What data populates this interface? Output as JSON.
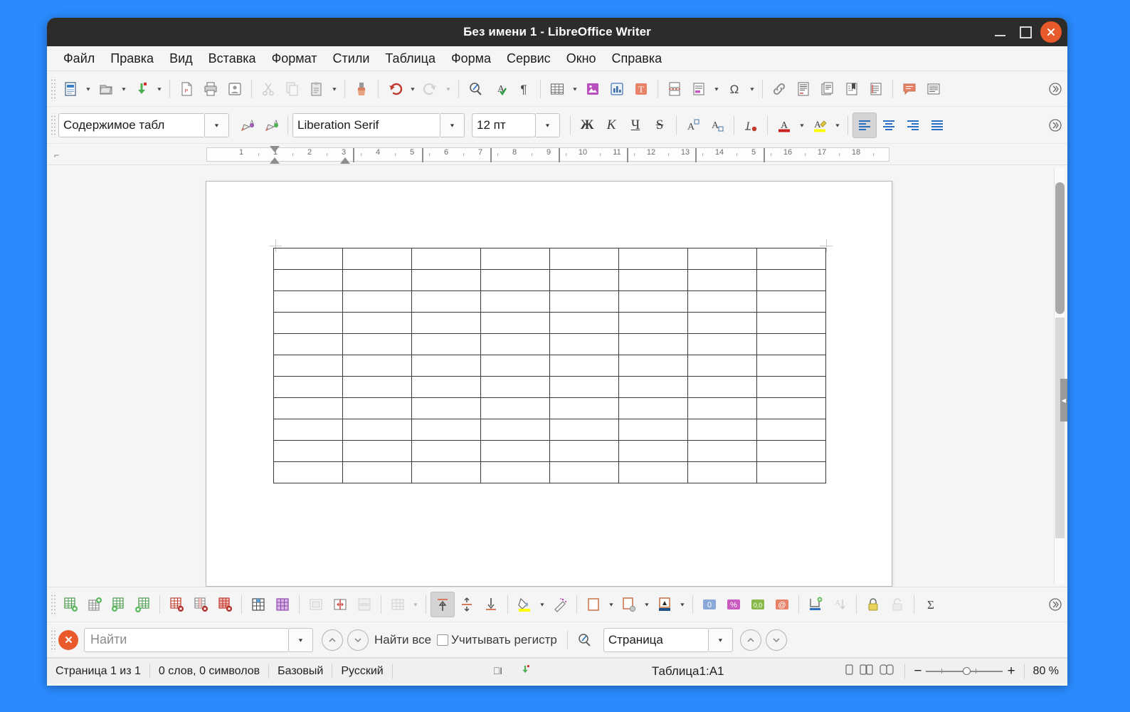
{
  "window": {
    "title": "Без имени 1 - LibreOffice Writer",
    "minimize": "—",
    "maximize": "□",
    "close": "✕"
  },
  "menubar": {
    "items": [
      {
        "label": "Файл",
        "name": "menu-file"
      },
      {
        "label": "Правка",
        "name": "menu-edit"
      },
      {
        "label": "Вид",
        "name": "menu-view"
      },
      {
        "label": "Вставка",
        "name": "menu-insert"
      },
      {
        "label": "Формат",
        "name": "menu-format"
      },
      {
        "label": "Стили",
        "name": "menu-styles"
      },
      {
        "label": "Таблица",
        "name": "menu-table"
      },
      {
        "label": "Форма",
        "name": "menu-form"
      },
      {
        "label": "Сервис",
        "name": "menu-tools"
      },
      {
        "label": "Окно",
        "name": "menu-window"
      },
      {
        "label": "Справка",
        "name": "menu-help"
      }
    ]
  },
  "standard_toolbar": {
    "overflow_label": "»",
    "buttons": [
      {
        "name": "new-document-icon",
        "tip": "Создать"
      },
      {
        "name": "open-document-icon",
        "tip": "Открыть"
      },
      {
        "name": "save-document-icon",
        "tip": "Сохранить"
      },
      {
        "name": "export-pdf-icon",
        "tip": "Экспорт в PDF"
      },
      {
        "name": "print-icon",
        "tip": "Печать"
      },
      {
        "name": "print-preview-icon",
        "tip": "Предварительный просмотр"
      },
      {
        "name": "cut-icon",
        "tip": "Вырезать"
      },
      {
        "name": "copy-icon",
        "tip": "Копировать"
      },
      {
        "name": "paste-icon",
        "tip": "Вставить"
      },
      {
        "name": "clone-formatting-icon",
        "tip": "Клонировать форматирование"
      },
      {
        "name": "undo-icon",
        "tip": "Отменить"
      },
      {
        "name": "redo-icon",
        "tip": "Вернуть"
      },
      {
        "name": "find-replace-icon",
        "tip": "Найти и заменить"
      },
      {
        "name": "spelling-icon",
        "tip": "Проверка орфографии"
      },
      {
        "name": "formatting-marks-icon",
        "tip": "Непечатаемые символы"
      },
      {
        "name": "insert-table-icon",
        "tip": "Вставить таблицу"
      },
      {
        "name": "insert-image-icon",
        "tip": "Вставить изображение"
      },
      {
        "name": "insert-chart-icon",
        "tip": "Вставить диаграмму"
      },
      {
        "name": "insert-textbox-icon",
        "tip": "Вставить текстовое поле"
      },
      {
        "name": "page-break-icon",
        "tip": "Разрыв страницы"
      },
      {
        "name": "insert-field-icon",
        "tip": "Вставить поле"
      },
      {
        "name": "special-character-icon",
        "tip": "Специальный символ"
      },
      {
        "name": "hyperlink-icon",
        "tip": "Гиперссылка"
      },
      {
        "name": "footnote-icon",
        "tip": "Сноска"
      },
      {
        "name": "endnote-icon",
        "tip": "Концевая сноска"
      },
      {
        "name": "bookmark-icon",
        "tip": "Закладка"
      },
      {
        "name": "cross-reference-icon",
        "tip": "Перекрёстная ссылка"
      },
      {
        "name": "comment-icon",
        "tip": "Комментарий"
      },
      {
        "name": "track-changes-icon",
        "tip": "Отслеживание изменений"
      }
    ]
  },
  "formatting_toolbar": {
    "paragraph_style": "Содержимое табл",
    "font_name": "Liberation Serif",
    "font_size": "12 пт",
    "overflow_label": "»",
    "buttons": {
      "bold": "Ж",
      "italic": "К",
      "underline": "Ч",
      "strikethrough": "S",
      "superscript": "A²",
      "subscript": "A₂",
      "clear_formatting": "I",
      "font_color": "A",
      "highlight_color": "A",
      "align_left": "align-left",
      "align_center": "align-center",
      "align_right": "align-right",
      "align_justify": "align-justify"
    },
    "colors": {
      "font_color": "#c9211e",
      "highlight_color": "#ffff00",
      "active_button_bg": "#d4d4d4"
    }
  },
  "ruler": {
    "ticks": [
      "1",
      "1",
      "2",
      "3",
      "4",
      "5",
      "6",
      "7",
      "8",
      "9",
      "10",
      "11",
      "12",
      "13",
      "14",
      "5",
      "16",
      "17",
      "18"
    ],
    "unit_hint": "см"
  },
  "document": {
    "table_name": "Таблица1",
    "table": {
      "rows": 11,
      "columns": 8,
      "cells": []
    }
  },
  "table_toolbar": {
    "overflow_label": "»",
    "buttons": [
      {
        "name": "insert-row-above-icon",
        "tip": "Вставить строку выше"
      },
      {
        "name": "insert-row-below-icon",
        "tip": "Вставить строку ниже"
      },
      {
        "name": "insert-column-before-icon",
        "tip": "Вставить столбец слева"
      },
      {
        "name": "insert-column-after-icon",
        "tip": "Вставить столбец справа"
      },
      {
        "name": "delete-row-icon",
        "tip": "Удалить строку"
      },
      {
        "name": "delete-column-icon",
        "tip": "Удалить столбец"
      },
      {
        "name": "delete-table-icon",
        "tip": "Удалить таблицу"
      },
      {
        "name": "select-cell-icon",
        "tip": "Выделить ячейку"
      },
      {
        "name": "select-table-icon",
        "tip": "Выделить таблицу"
      },
      {
        "name": "merge-cells-icon",
        "tip": "Объединить ячейки"
      },
      {
        "name": "split-cells-icon",
        "tip": "Разбить ячейки"
      },
      {
        "name": "merge-table-icon",
        "tip": "Объединить таблицу"
      },
      {
        "name": "optimize-size-icon",
        "tip": "Оптимальный размер"
      },
      {
        "name": "align-top-icon",
        "tip": "Выровнять по верху"
      },
      {
        "name": "center-vertically-icon",
        "tip": "Центрировать по вертикали"
      },
      {
        "name": "align-bottom-icon",
        "tip": "Выровнять по низу"
      },
      {
        "name": "table-background-color-icon",
        "tip": "Цвет фона таблицы"
      },
      {
        "name": "autoformat-styles-icon",
        "tip": "Автоформат"
      },
      {
        "name": "borders-icon",
        "tip": "Обрамление"
      },
      {
        "name": "border-style-icon",
        "tip": "Стиль обрамления"
      },
      {
        "name": "border-color-icon",
        "tip": "Цвет обрамления"
      },
      {
        "name": "number-format-number-icon",
        "tip": "Числовой формат: числовой"
      },
      {
        "name": "number-format-percent-icon",
        "tip": "Числовой формат: процентный"
      },
      {
        "name": "number-format-decimal-icon",
        "tip": "Числовой формат: десятичный"
      },
      {
        "name": "number-format-currency-icon",
        "tip": "Числовой формат: денежный"
      },
      {
        "name": "insert-caption-icon",
        "tip": "Вставить название"
      },
      {
        "name": "sort-icon",
        "tip": "Сортировка"
      },
      {
        "name": "protect-cells-icon",
        "tip": "Защитить ячейки"
      },
      {
        "name": "unprotect-cells-icon",
        "tip": "Снять защиту ячеек"
      },
      {
        "name": "sum-icon",
        "tip": "Сумма"
      }
    ],
    "number_format_labels": {
      "number": "0",
      "percent": "%",
      "decimal": "0,0",
      "currency": "@"
    }
  },
  "find_toolbar": {
    "close_label": "✕",
    "search_placeholder": "Найти",
    "search_value": "",
    "prev_label": "⌃",
    "next_label": "⌄",
    "find_all_label": "Найти все",
    "match_case_label": "Учитывать регистр",
    "match_case_checked": false,
    "find_replace_label": "Найти и заменить",
    "navigate_by": "Страница",
    "nav_prev_label": "⌃",
    "nav_next_label": "⌄"
  },
  "statusbar": {
    "page_info": "Страница 1 из 1",
    "word_count": "0 слов, 0 символов",
    "page_style": "Базовый",
    "language": "Русский",
    "selection_mode": "⎕I",
    "save_state": "save-indicator",
    "table_cell": "Таблица1:A1",
    "view_single": "single-page-view",
    "view_multi": "multi-page-view",
    "view_book": "book-view",
    "zoom_out": "−",
    "zoom_in": "+",
    "zoom_level": "80 %"
  }
}
